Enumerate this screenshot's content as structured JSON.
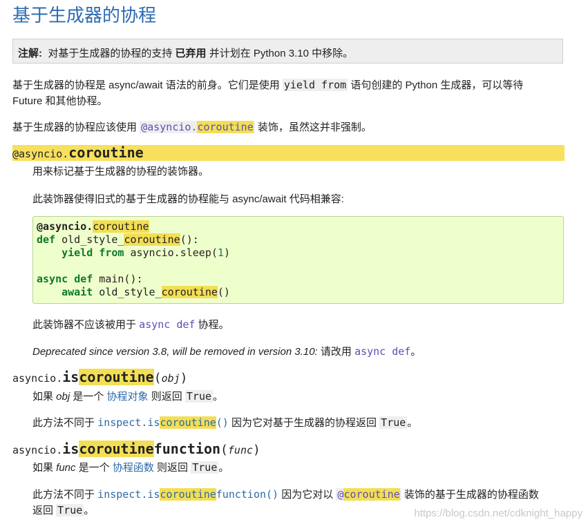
{
  "title": "基于生成器的协程",
  "note": {
    "label": "注解:",
    "text_1": "对基于生成器的协程的支持 ",
    "text_bold": "已弃用",
    "text_2": " 并计划在 Python 3.10 中移除。"
  },
  "para1": {
    "line1_a": "基于生成器的协程是 async/await 语法的前身。它们是使用 ",
    "line1_code": "yield from",
    "line1_b": " 语句创建的 Python 生成器，可以等待",
    "line2": "Future 和其他协程。"
  },
  "para2": {
    "text_a": "基于生成器的协程应该使用 ",
    "link_prefix": "@asyncio.",
    "link_hl": "coroutine",
    "text_b": " 装饰，虽然这并非强制。"
  },
  "decorator": {
    "sig_prefix": "@asyncio.",
    "sig_name": "coroutine",
    "desc": "用来标记基于生成器的协程的装饰器。",
    "compat": "此装饰器使得旧式的基于生成器的协程能与 async/await 代码相兼容:",
    "code": {
      "l1_prefix": "@asyncio.",
      "l1_hl": "coroutine",
      "l2_kw": "def",
      "l2_a": " old_style_",
      "l2_hl": "coroutine",
      "l2_b": "():",
      "l3_kw1": "yield",
      "l3_kw2": "from",
      "l3_a": " asyncio.sleep(",
      "l3_num": "1",
      "l3_b": ")",
      "l5_kw1": "async",
      "l5_kw2": "def",
      "l5_a": " main():",
      "l6_kw": "await",
      "l6_a": " old_style_",
      "l6_hl": "coroutine",
      "l6_b": "()"
    },
    "not_for_a": "此装饰器不应该被用于 ",
    "not_for_code": "async def",
    "not_for_b": " 协程。",
    "deprecated_italic": "Deprecated since version 3.8, will be removed in version 3.10:",
    "deprecated_a": " 请改用 ",
    "deprecated_code": "async def",
    "deprecated_b": "。"
  },
  "iscoroutine": {
    "sig_prefix": "asyncio.",
    "sig_name_a": "is",
    "sig_name_hl": "coroutine",
    "sig_paren_open": "(",
    "sig_arg": "obj",
    "sig_paren_close": ")",
    "desc_a": "如果 ",
    "desc_obj": "obj",
    "desc_b": " 是一个 ",
    "desc_link": "协程对象",
    "desc_c": " 则返回 ",
    "desc_code": "True",
    "desc_d": "。",
    "diff_a": "此方法不同于 ",
    "diff_link_a": "inspect.is",
    "diff_link_hl": "coroutine",
    "diff_link_b": "()",
    "diff_b": " 因为它对基于生成器的协程返回 ",
    "diff_code": "True",
    "diff_c": "。"
  },
  "iscoroutinefunction": {
    "sig_prefix": "asyncio.",
    "sig_name_a": "is",
    "sig_name_hl": "coroutine",
    "sig_name_b": "function",
    "sig_paren_open": "(",
    "sig_arg": "func",
    "sig_paren_close": ")",
    "desc_a": "如果 ",
    "desc_func": "func",
    "desc_b": " 是一个 ",
    "desc_link": "协程函数",
    "desc_c": " 则返回 ",
    "desc_code": "True",
    "desc_d": "。",
    "diff_a": "此方法不同于 ",
    "diff_link_a": "inspect.is",
    "diff_link_hl": "coroutine",
    "diff_link_b": "function()",
    "diff_b": " 因为它对以 ",
    "diff_dec_prefix": "@",
    "diff_dec_hl": "coroutine",
    "diff_c": " 装饰的基于生成器的协程函数",
    "diff_line2_a": "返回 ",
    "diff_line2_code": "True",
    "diff_line2_b": "。"
  },
  "watermark": "https://blog.csdn.net/cdknight_happy"
}
